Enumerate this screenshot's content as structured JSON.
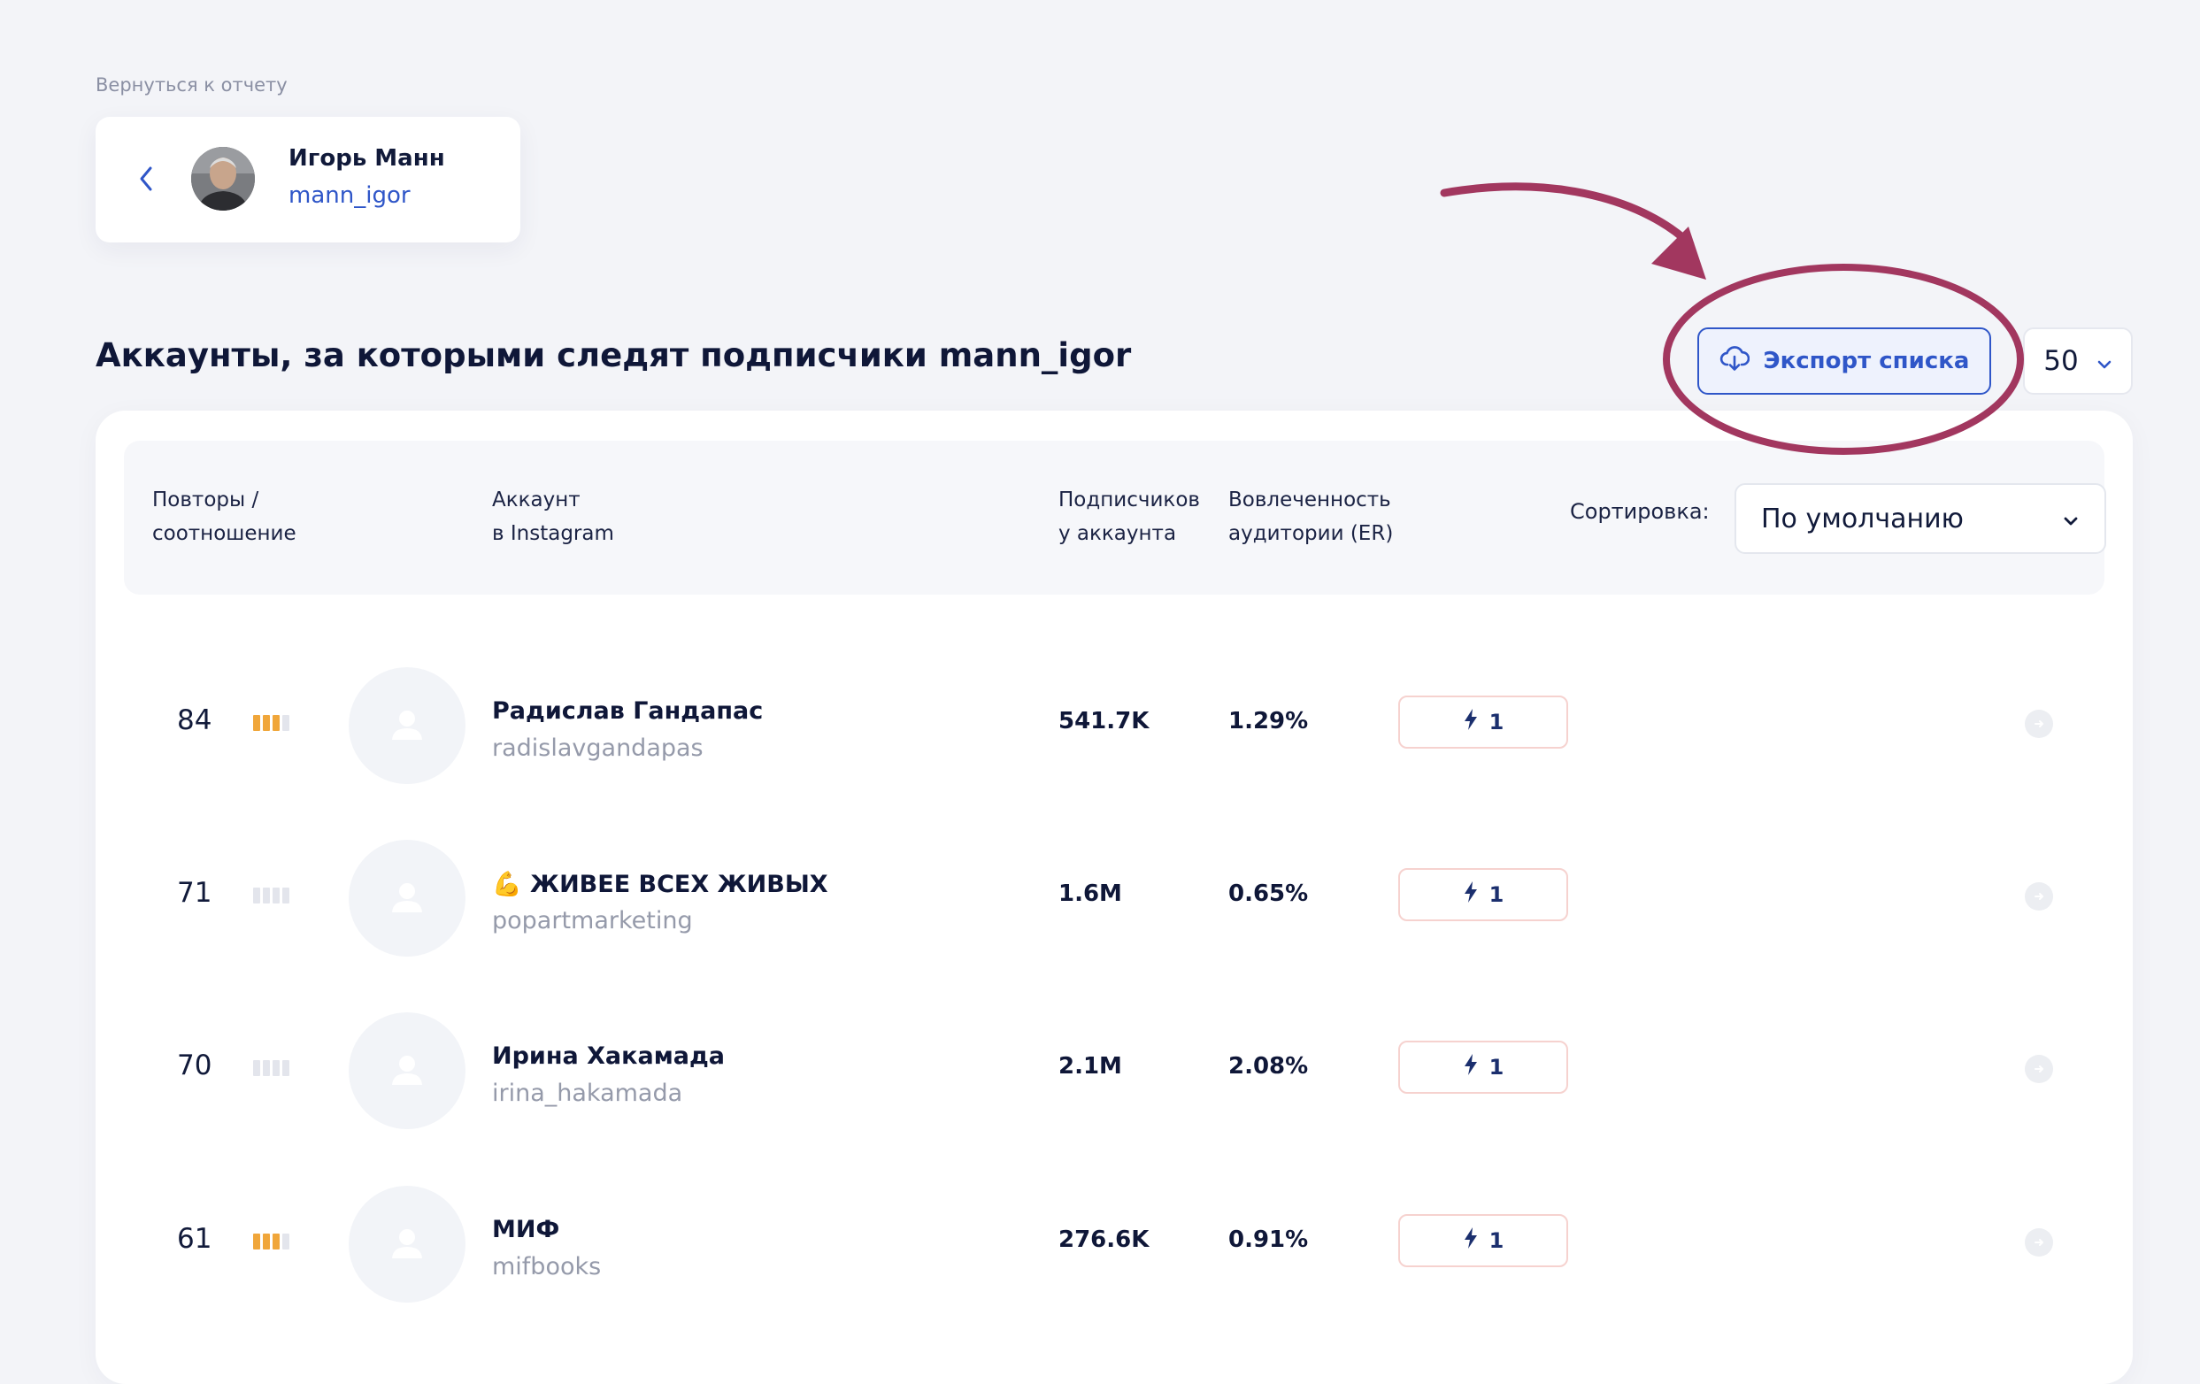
{
  "back_link": "Вернуться к отчету",
  "profile": {
    "name": "Игорь Манн",
    "handle": "mann_igor"
  },
  "page_title": "Аккаунты, за которыми следят подписчики mann_igor",
  "export_button": {
    "label": "Экспорт списка"
  },
  "per_page": {
    "value": "50"
  },
  "table": {
    "headers": {
      "repeats_1": "Повторы /",
      "repeats_2": "соотношение",
      "account_1": "Аккаунт",
      "account_2": "в Instagram",
      "followers_1": "Подписчиков",
      "followers_2": "у аккаунта",
      "er_1": "Вовлеченность",
      "er_2": "аудитории (ER)"
    },
    "sort": {
      "label": "Сортировка:",
      "value": "По умолчанию"
    },
    "rows": [
      {
        "rank": "84",
        "level": 3,
        "name": "Радислав Гандапас",
        "handle": "radislavgandapas",
        "followers": "541.7K",
        "er": "1.29%",
        "badge": "1"
      },
      {
        "rank": "71",
        "level": 0,
        "name": "💪  ЖИВЕЕ ВСЕХ ЖИВЫХ",
        "handle": "popartmarketing",
        "followers": "1.6M",
        "er": "0.65%",
        "badge": "1"
      },
      {
        "rank": "70",
        "level": 0,
        "name": "Ирина Хакамада",
        "handle": "irina_hakamada",
        "followers": "2.1M",
        "er": "2.08%",
        "badge": "1"
      },
      {
        "rank": "61",
        "level": 3,
        "name": "МИФ",
        "handle": "mifbooks",
        "followers": "276.6K",
        "er": "0.91%",
        "badge": "1"
      }
    ]
  },
  "colors": {
    "accent": "#2f56c8",
    "bar_active": "#f0a63a",
    "bar_inactive": "#e3e5ec",
    "annotation": "#a2375f"
  },
  "icons": {
    "back": "chevron-left-icon",
    "export": "cloud-download-icon",
    "dropdown": "chevron-down-icon",
    "badge": "lightning-icon",
    "row_action": "arrow-right-circle-icon",
    "avatar_placeholder": "user-icon"
  }
}
